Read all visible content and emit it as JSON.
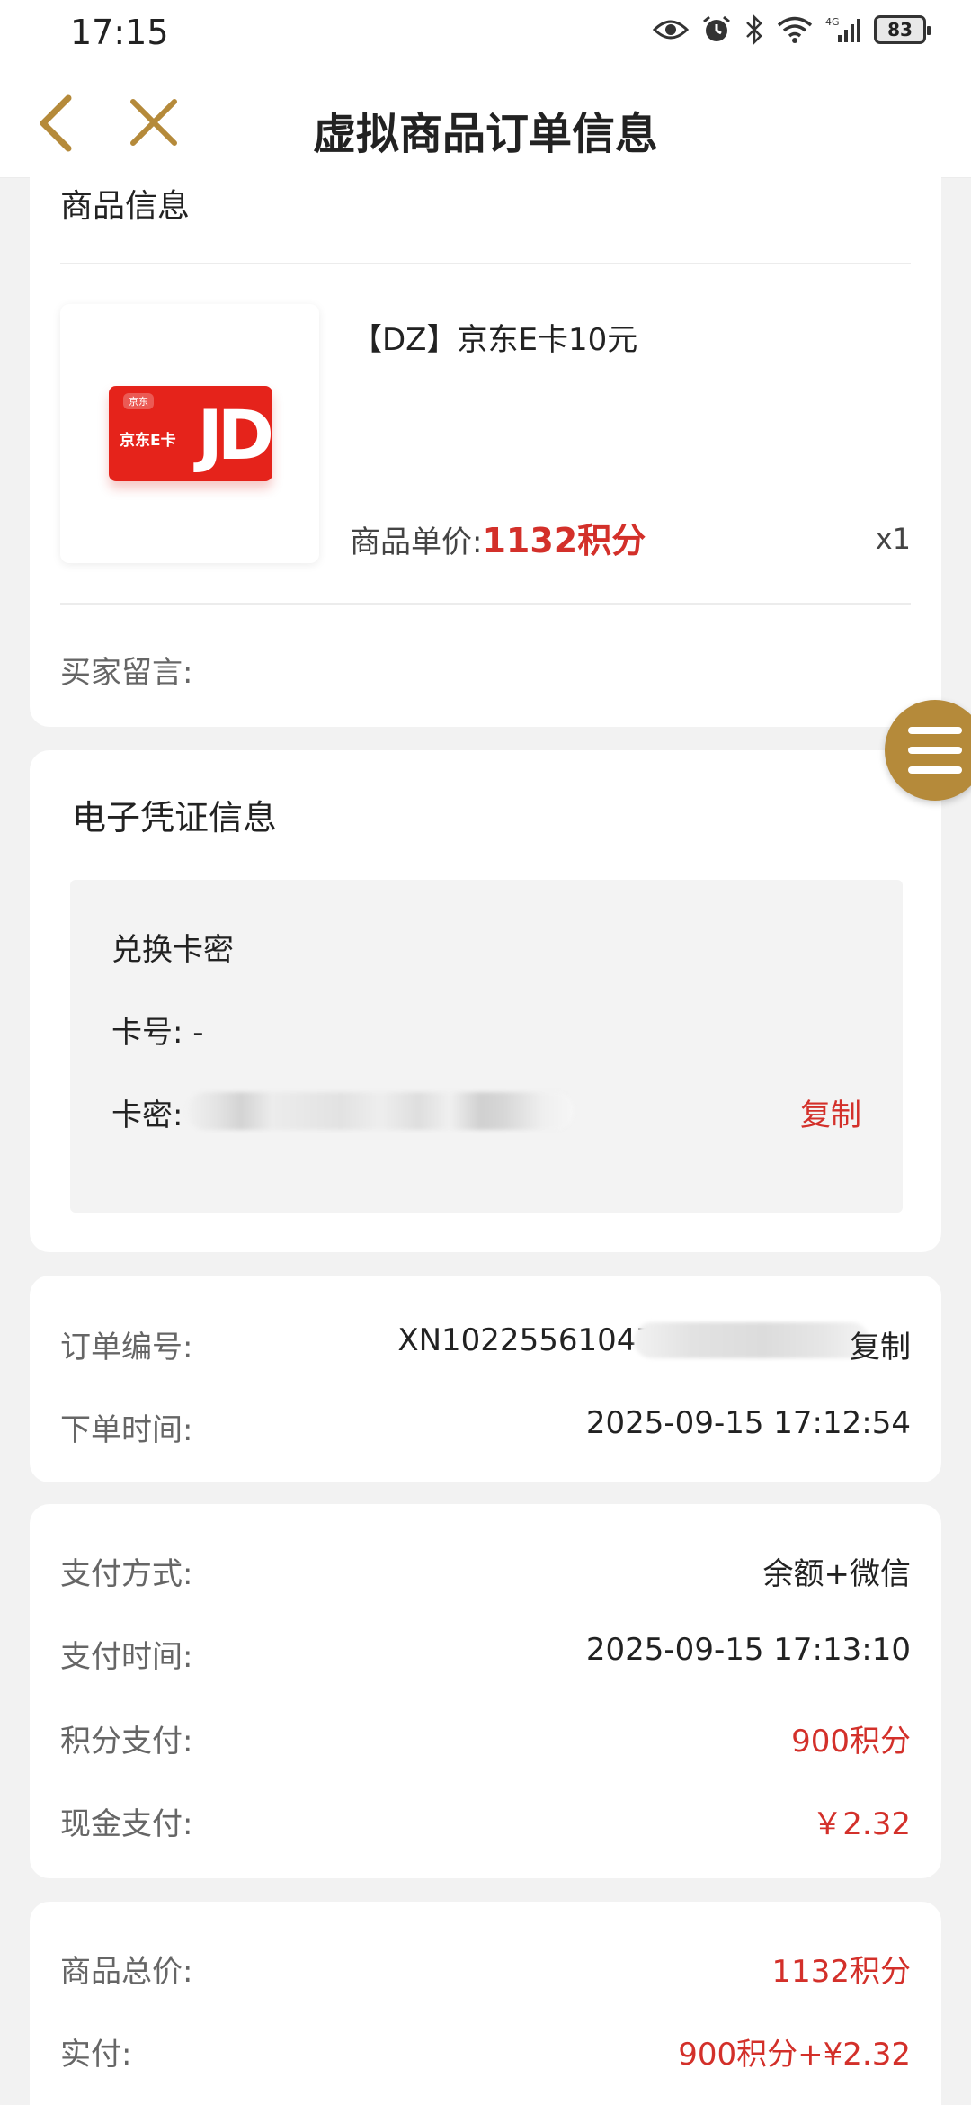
{
  "status_bar": {
    "time": "17:15",
    "battery": "83"
  },
  "header": {
    "title": "虚拟商品订单信息"
  },
  "product_section": {
    "title": "商品信息",
    "thumbnail": {
      "brand_tag": "京东",
      "card_name": "京东E卡",
      "logo": "JD"
    },
    "product_name": "【DZ】京东E卡10元",
    "price_label": "商品单价:",
    "price_value": "1132积分",
    "quantity": "x1",
    "buyer_message_label": "买家留言:"
  },
  "voucher_section": {
    "title": "电子凭证信息",
    "box_title": "兑换卡密",
    "card_number_label": "卡号:  -",
    "card_password_label": "卡密:",
    "copy_label": "复制"
  },
  "order_section": {
    "order_no_label": "订单编号:",
    "order_no_value": "XN10225561047",
    "copy_label": "复制",
    "order_time_label": "下单时间:",
    "order_time_value": "2025-09-15 17:12:54"
  },
  "payment_section": {
    "method_label": "支付方式:",
    "method_value": "余额+微信",
    "pay_time_label": "支付时间:",
    "pay_time_value": "2025-09-15 17:13:10",
    "points_label": "积分支付:",
    "points_value": "900积分",
    "cash_label": "现金支付:",
    "cash_value": "￥2.32"
  },
  "total_section": {
    "total_label": "商品总价:",
    "total_value": "1132积分",
    "paid_label": "实付:",
    "paid_value": "900积分+¥2.32"
  },
  "colors": {
    "accent_gold": "#b58a3a",
    "price_red": "#d3302a"
  }
}
